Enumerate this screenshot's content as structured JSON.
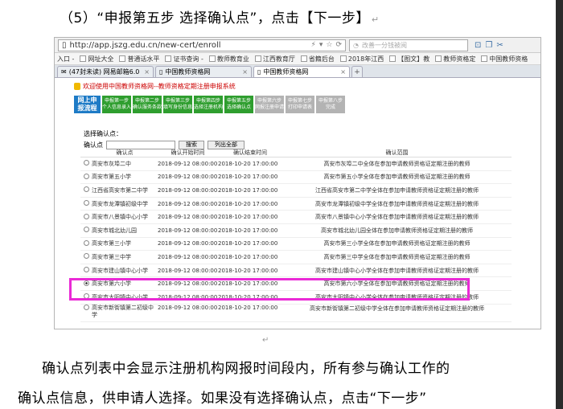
{
  "heading": "（5）“申报第五步 选择确认点”，点击【下一步】",
  "para_mark": "↵",
  "browser": {
    "url": "http://app.jszg.edu.cn/new-cert/enroll",
    "search_placeholder": "改善一分钱被阅",
    "bookmarks": [
      "入口 -",
      "网址大全",
      "普通话水平",
      "证书查询 -",
      "教师教育业",
      "江西教育厅",
      "省籍后台",
      "2018年江西",
      "【图文】教",
      "教师资格定",
      "中国教师资格"
    ],
    "tabs": [
      {
        "label": "(47封未读) 网易邮箱6.0",
        "active": false
      },
      {
        "label": "中国教师资格网",
        "active": false
      },
      {
        "label": "中国教师资格网",
        "active": true
      }
    ]
  },
  "page": {
    "welcome": "欢迎使用中国教师资格网--教师资格定期注册申报系统",
    "step_main": [
      "网上申",
      "报流程"
    ],
    "steps": [
      {
        "l1": "申报第一步",
        "l2": "个人信息录入",
        "done": true
      },
      {
        "l1": "申报第二步",
        "l2": "确认服务条款",
        "done": true
      },
      {
        "l1": "申报第三步",
        "l2": "填写身份信息",
        "done": true
      },
      {
        "l1": "申报第四步",
        "l2": "选择注册机构",
        "done": true
      },
      {
        "l1": "申报第五步",
        "l2": "选择确认点",
        "done": true
      },
      {
        "l1": "申报第六步",
        "l2": "网报注册申请",
        "done": false
      },
      {
        "l1": "申报第七步",
        "l2": "打印申请表",
        "done": false
      },
      {
        "l1": "申报第八步",
        "l2": "完成",
        "done": false
      }
    ],
    "select_title": "选择确认点：",
    "search_label": "确认点",
    "search_button": "搜索",
    "list_all_button": "列出全部",
    "headers": [
      "确认点",
      "确认开始时间",
      "确认结束时间",
      "确认范围"
    ],
    "rows": [
      {
        "name": "高安市灰埠二中",
        "start": "2018-09-12 08:00:00",
        "end": "2018-10-20 17:00:00",
        "scope": "高安市灰埠二中全体在参加申请教师资格证定期注册的教师",
        "selected": false
      },
      {
        "name": "高安市第五小学",
        "start": "2018-09-12 08:00:00",
        "end": "2018-10-20 17:00:00",
        "scope": "高安市第五小学全体在参加申请教师资格证定期注册的教师",
        "selected": false
      },
      {
        "name": "江西省高安市第二中学",
        "start": "2018-09-12 08:00:00",
        "end": "2018-10-20 17:00:00",
        "scope": "江西省高安市第二中学全体在参加申请教师资格证定期注册的教师",
        "selected": false
      },
      {
        "name": "高安市龙潭镇初级中学",
        "start": "2018-09-12 08:00:00",
        "end": "2018-10-20 17:00:00",
        "scope": "高安市龙潭镇初级中学全体在参加申请教师资格证定期注册的教师",
        "selected": false
      },
      {
        "name": "高安市八景镇中心小学",
        "start": "2018-09-12 08:00:00",
        "end": "2018-10-20 17:00:00",
        "scope": "高安市八景镇中心小学全体在参加申请教师资格证定期注册的教师",
        "selected": false
      },
      {
        "name": "高安市城北幼儿园",
        "start": "2018-09-12 08:00:00",
        "end": "2018-10-20 17:00:00",
        "scope": "高安市城北幼儿园全体在参加申请教师资格证定期注册的教师",
        "selected": false
      },
      {
        "name": "高安市第三小学",
        "start": "2018-09-12 08:00:00",
        "end": "2018-10-20 17:00:00",
        "scope": "高安市第三小学全体在参加申请教师资格证定期注册的教师",
        "selected": false
      },
      {
        "name": "高安市第三中学",
        "start": "2018-09-12 08:00:00",
        "end": "2018-10-20 17:00:00",
        "scope": "高安市第三中学全体在参加申请教师资格证定期注册的教师",
        "selected": false
      },
      {
        "name": "高安市建山镇中心小学",
        "start": "2018-09-12 08:00:00",
        "end": "2018-10-20 17:00:00",
        "scope": "高安市建山镇中心小学全体在参加申请教师资格证定期注册的教师",
        "selected": false
      },
      {
        "name": "高安市第六小学",
        "start": "2018-09-12 08:00:00",
        "end": "2018-10-20 17:00:00",
        "scope": "高安市第六小学全体在参加申请教师资格证定期注册的教师",
        "selected": true
      },
      {
        "name": "高安市太阳镇中心小学",
        "start": "2018-09-12 08:00:00",
        "end": "2018-10-20 17:00:00",
        "scope": "高安市太阳镇中心小学全体在参加申请教师资格证定期注册的教师",
        "selected": false
      },
      {
        "name": "高安市新街镇第二初级中学",
        "start": "2018-09-12 08:00:00",
        "end": "2018-10-20 17:00:00",
        "scope": "高安市新街镇第二初级中学全体在参加申请教师资格证定期注册的教师",
        "selected": false
      }
    ]
  },
  "body_line1": "确认点列表中会显示注册机构网报时间段内，所有参与确认工作的",
  "body_line2": "确认点信息，供申请人选择。如果没有选择确认点，点击“下一步”",
  "colors": {
    "highlight": "#ea2ad6",
    "step_done": "#2f9e2f",
    "step_main": "#1e7bc6",
    "step_todo": "#b3b3b3"
  }
}
